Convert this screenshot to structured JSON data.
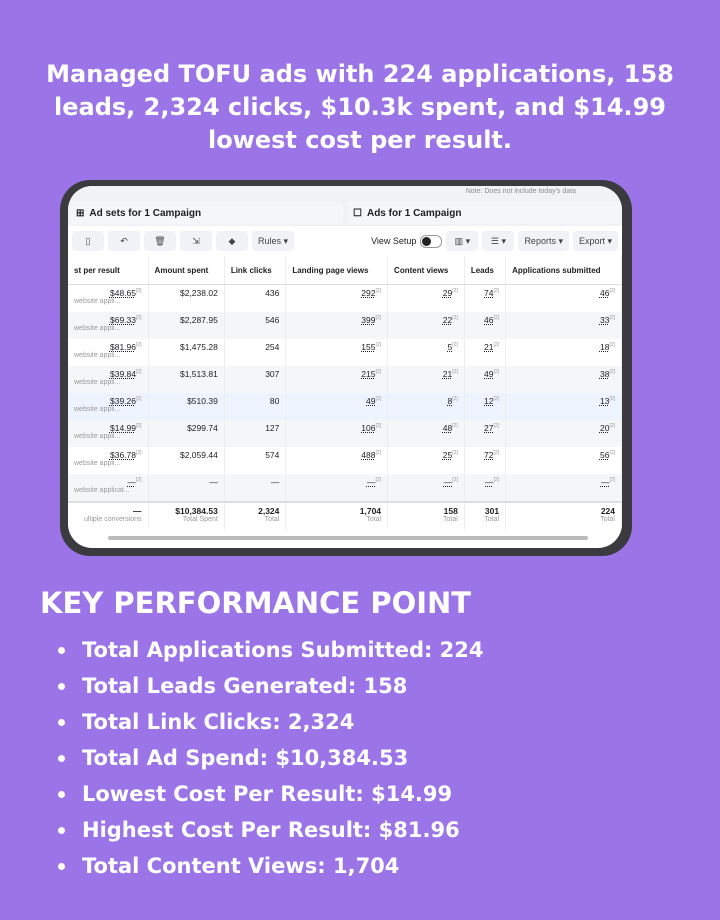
{
  "headline": "Managed TOFU ads with 224 applications, 158 leads, 2,324 clicks, $10.3k spent, and $14.99 lowest cost per result.",
  "screen": {
    "note": "Note: Does not include today's data",
    "tabs": [
      {
        "label": "Ad sets for 1 Campaign",
        "icon": "grid-icon"
      },
      {
        "label": "Ads for 1 Campaign",
        "icon": "ad-icon"
      }
    ],
    "toolbar": {
      "rules": "Rules ▾",
      "view_setup": "View Setup",
      "columns": "▥ ▾",
      "breakdown": "☰ ▾",
      "reports": "Reports ▾",
      "export": "Export ▾"
    },
    "columns": [
      "st per result",
      "Amount spent",
      "Link clicks",
      "Landing page views",
      "Content views",
      "Leads",
      "Applications submitted"
    ],
    "rows": [
      {
        "cost": "$48.65",
        "sub": "website appli...",
        "spent": "$2,238.02",
        "clicks": "436",
        "lpv": "292",
        "cv": "29",
        "leads": "74",
        "apps": "46"
      },
      {
        "cost": "$69.33",
        "sub": "website appli...",
        "spent": "$2,287.95",
        "clicks": "546",
        "lpv": "399",
        "cv": "22",
        "leads": "46",
        "apps": "33"
      },
      {
        "cost": "$81.96",
        "sub": "website appli...",
        "spent": "$1,475.28",
        "clicks": "254",
        "lpv": "155",
        "cv": "5",
        "leads": "21",
        "apps": "18"
      },
      {
        "cost": "$39.84",
        "sub": "website appli...",
        "spent": "$1,513.81",
        "clicks": "307",
        "lpv": "215",
        "cv": "21",
        "leads": "49",
        "apps": "38"
      },
      {
        "cost": "$39.26",
        "sub": "website appli...",
        "spent": "$510.39",
        "clicks": "80",
        "lpv": "49",
        "cv": "8",
        "leads": "12",
        "apps": "13"
      },
      {
        "cost": "$14.99",
        "sub": "website appli...",
        "spent": "$299.74",
        "clicks": "127",
        "lpv": "106",
        "cv": "48",
        "leads": "27",
        "apps": "20"
      },
      {
        "cost": "$36.78",
        "sub": "website appli...",
        "spent": "$2,059.44",
        "clicks": "574",
        "lpv": "488",
        "cv": "25",
        "leads": "72",
        "apps": "56"
      },
      {
        "cost": "—",
        "sub": "website applicat...",
        "spent": "—",
        "clicks": "—",
        "lpv": "—",
        "cv": "—",
        "leads": "—",
        "apps": "—"
      }
    ],
    "totals": {
      "cost": "—",
      "cost_sub": "ultiple conversions",
      "spent": "$10,384.53",
      "spent_sub": "Total Spent",
      "clicks": "2,324",
      "lpv": "1,704",
      "cv": "158",
      "leads": "301",
      "apps": "224",
      "total_label": "Total"
    }
  },
  "kpi": {
    "title": "KEY PERFORMANCE POINT",
    "items": [
      "Total Applications Submitted: 224",
      "Total Leads Generated: 158",
      "Total Link Clicks: 2,324",
      "Total Ad Spend: $10,384.53",
      "Lowest Cost Per Result: $14.99",
      "Highest Cost Per Result: $81.96",
      "Total Content Views: 1,704"
    ]
  }
}
